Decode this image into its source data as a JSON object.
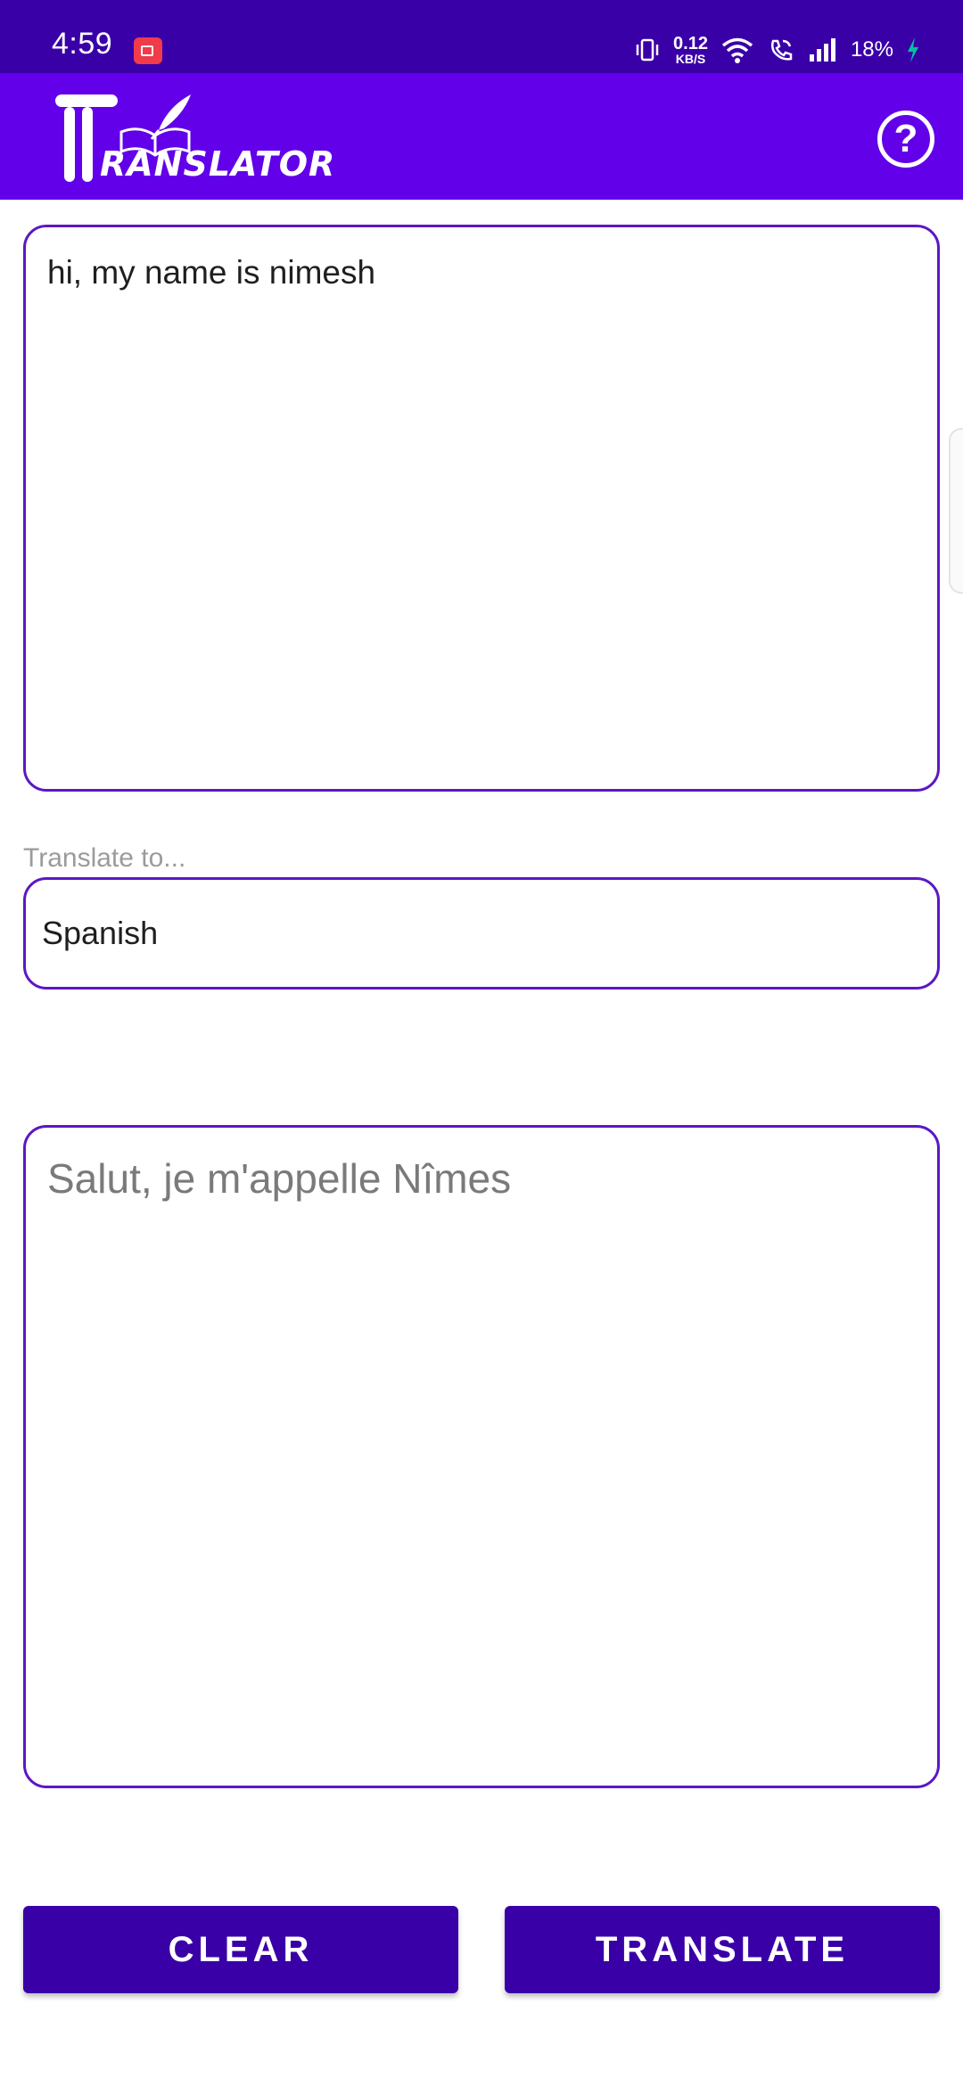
{
  "status_bar": {
    "time": "4:59",
    "net_speed_value": "0.12",
    "net_speed_unit": "KB/S",
    "battery": "18%",
    "icons": [
      "screen-record-icon",
      "vibrate-icon",
      "wifi-icon",
      "wifi-calling-icon",
      "cellular-signal-icon",
      "battery-charging-icon"
    ]
  },
  "app_bar": {
    "logo_text": "RANSLATOR",
    "help_icon_glyph": "?"
  },
  "input": {
    "text": "hi, my name is nimesh"
  },
  "language": {
    "label": "Translate to...",
    "selected": "Spanish"
  },
  "output": {
    "text": "Salut, je m'appelle Nîmes"
  },
  "buttons": {
    "clear_label": "CLEAR",
    "translate_label": "TRANSLATE"
  },
  "colors": {
    "status_bar": "#3a00a8",
    "app_bar": "#6200ea",
    "border": "#5c17c4",
    "button": "#3a00a8"
  }
}
